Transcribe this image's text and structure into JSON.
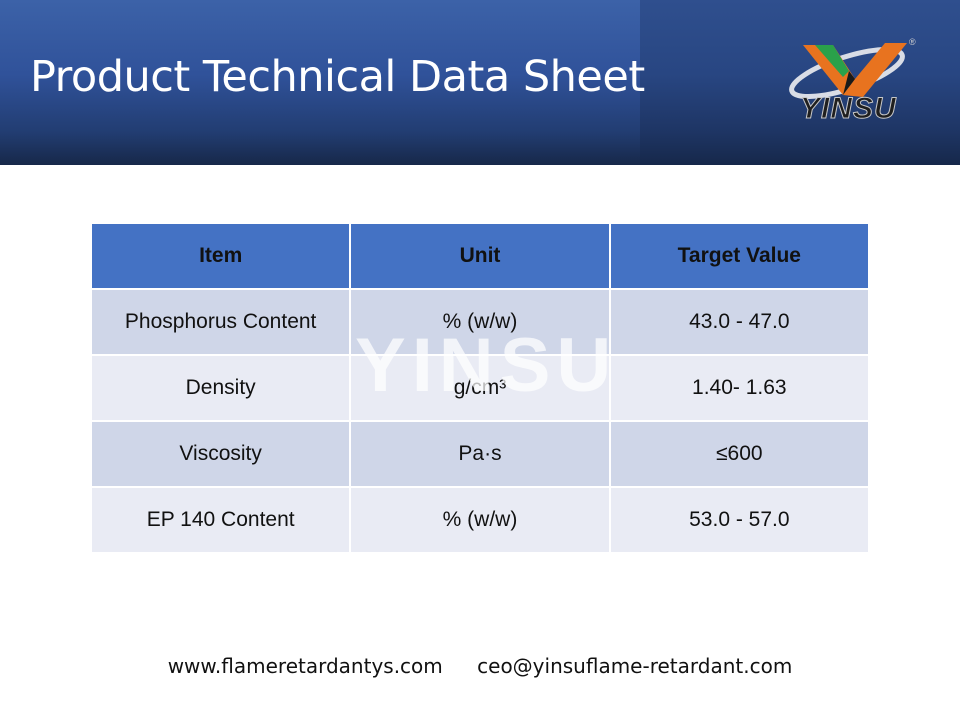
{
  "header": {
    "title": "Product Technical Data Sheet",
    "logo_text": "YINSU",
    "logo_mark": "®"
  },
  "table": {
    "columns": [
      "Item",
      "Unit",
      "Target Value"
    ],
    "rows": [
      {
        "item": "Phosphorus Content",
        "unit": "% (w/w)",
        "value": "43.0 - 47.0"
      },
      {
        "item": "Density",
        "unit": "g/cm³",
        "value": "1.40- 1.63"
      },
      {
        "item": "Viscosity",
        "unit": "Pa·s",
        "value": "≤600"
      },
      {
        "item": "EP 140 Content",
        "unit": "% (w/w)",
        "value": "53.0 - 57.0"
      }
    ]
  },
  "watermark": "YINSU",
  "footer": {
    "website": "www.flameretardantys.com",
    "email": "ceo@yinsuflame-retardant.com"
  },
  "colors": {
    "header_blue": "#30529a",
    "table_header": "#4472c4",
    "row_odd": "#cfd6e8",
    "row_even": "#e9ebf4",
    "logo_orange": "#e8731f",
    "logo_green": "#2aa14a"
  }
}
